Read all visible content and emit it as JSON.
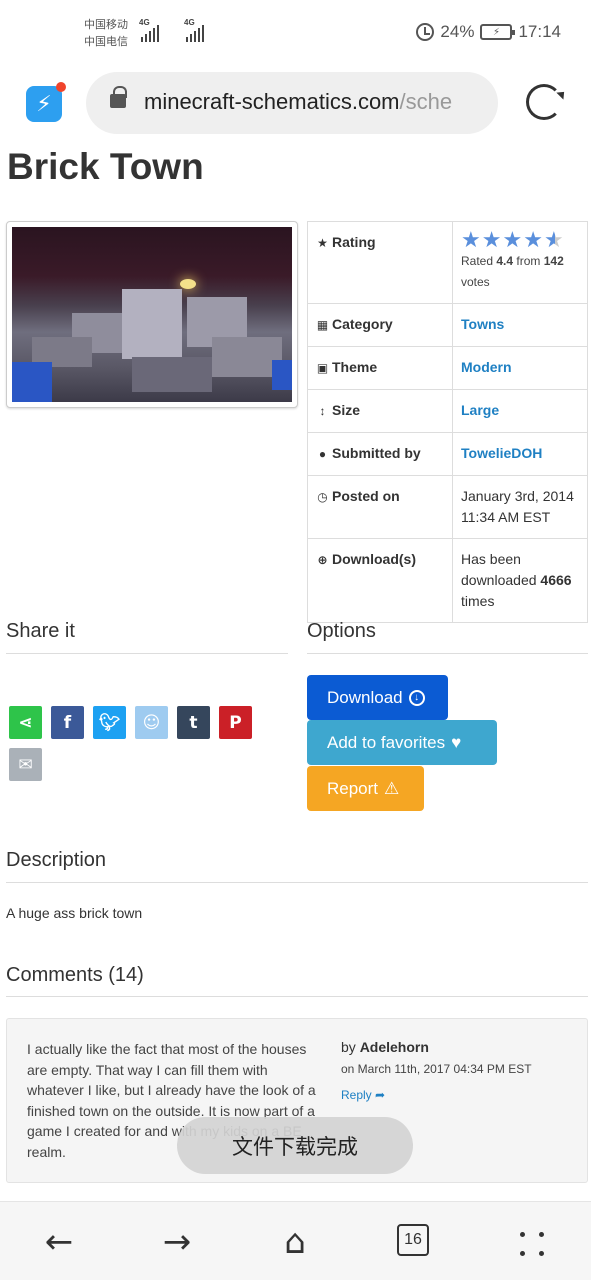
{
  "status": {
    "carrier1": "中国移动",
    "carrier2": "中国电信",
    "net1": "4G",
    "net2": "4G",
    "battery": "24%",
    "time": "17:14"
  },
  "browser": {
    "url_main": "minecraft-schematics.com",
    "url_rest": "/sche",
    "tab_count": "16"
  },
  "page": {
    "title": "Brick Town",
    "rating": {
      "label": "Rating",
      "value": "4.4",
      "votes": "142",
      "text_rated": "Rated",
      "text_from": "from",
      "text_votes": "votes"
    },
    "info": [
      {
        "label": "Category",
        "value": "Towns",
        "icon": "grid-icon"
      },
      {
        "label": "Theme",
        "value": "Modern",
        "icon": "image-icon"
      },
      {
        "label": "Size",
        "value": "Large",
        "icon": "resize-vertical-icon"
      },
      {
        "label": "Submitted by",
        "value": "TowelieDOH",
        "icon": "user-icon"
      },
      {
        "label": "Posted on",
        "value": "January 3rd, 2014 11:34 AM EST",
        "icon": "clock-icon"
      },
      {
        "label": "Download(s)",
        "icon": "download-circle-icon",
        "pre": "Has been downloaded",
        "count": "4666",
        "post": "times"
      }
    ],
    "share_title": "Share it",
    "options_title": "Options",
    "buttons": {
      "download": "Download",
      "favorites": "Add to favorites",
      "report": "Report"
    },
    "description_title": "Description",
    "description": "A huge ass brick town",
    "comments_title": "Comments (14)",
    "comment": {
      "text": "I actually like the fact that most of the houses are empty. That way I can fill them with whatever I like, but I already have the look of a finished town on the outside. It is now part of a game I created for and with my kids on a BE realm.",
      "by_prefix": "by",
      "author": "Adelehorn",
      "date": "on March 11th, 2017 04:34 PM EST",
      "reply": "Reply"
    }
  },
  "toast": "文件下载完成",
  "colors": {
    "link": "#1f80c3",
    "download_btn": "#0b5bd3",
    "favorites_btn": "#3ea7cf",
    "report_btn": "#f5a623"
  }
}
